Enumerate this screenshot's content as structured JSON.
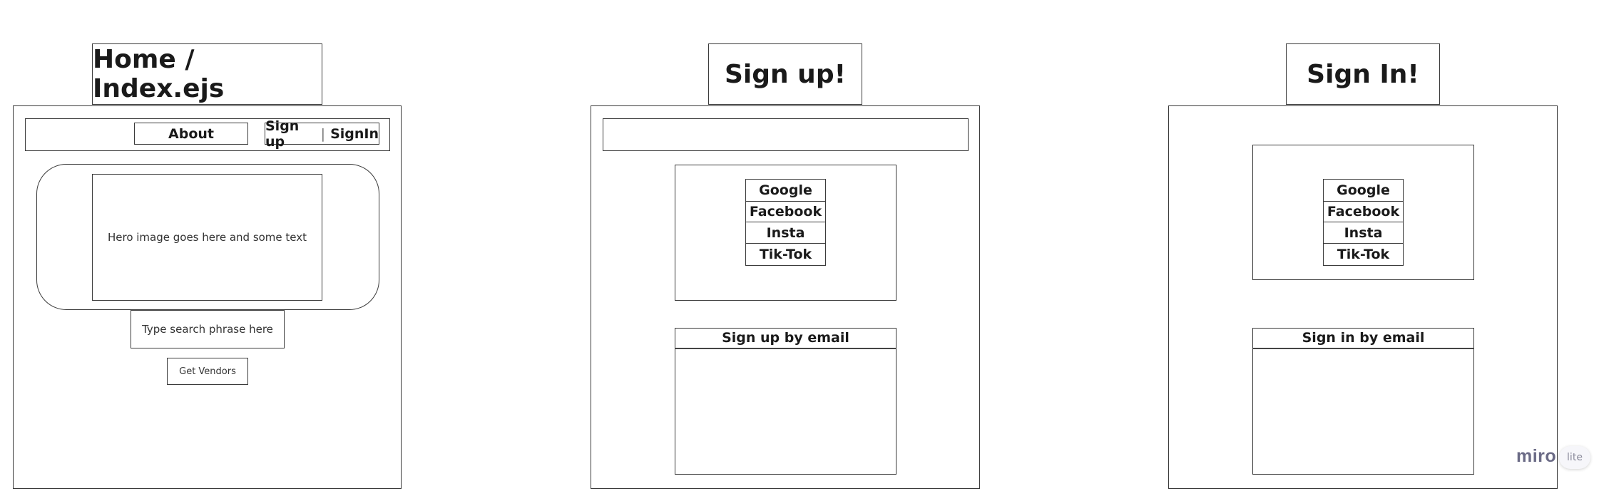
{
  "home": {
    "title": "Home / Index.ejs",
    "nav": {
      "about": "About",
      "signup": "Sign up",
      "separator": "|",
      "signin": "SignIn"
    },
    "hero_text": "Hero image goes here and some text",
    "search_placeholder": "Type search phrase here",
    "vendors_button": "Get Vendors"
  },
  "signup": {
    "title": "Sign up!",
    "social": [
      "Google",
      "Facebook",
      "Insta",
      "Tik-Tok"
    ],
    "email_heading": "Sign up by email"
  },
  "signin": {
    "title": "Sign In!",
    "social": [
      "Google",
      "Facebook",
      "Insta",
      "Tik-Tok"
    ],
    "email_heading": "Sign in by email"
  },
  "branding": {
    "logo": "miro",
    "badge": "lite"
  }
}
